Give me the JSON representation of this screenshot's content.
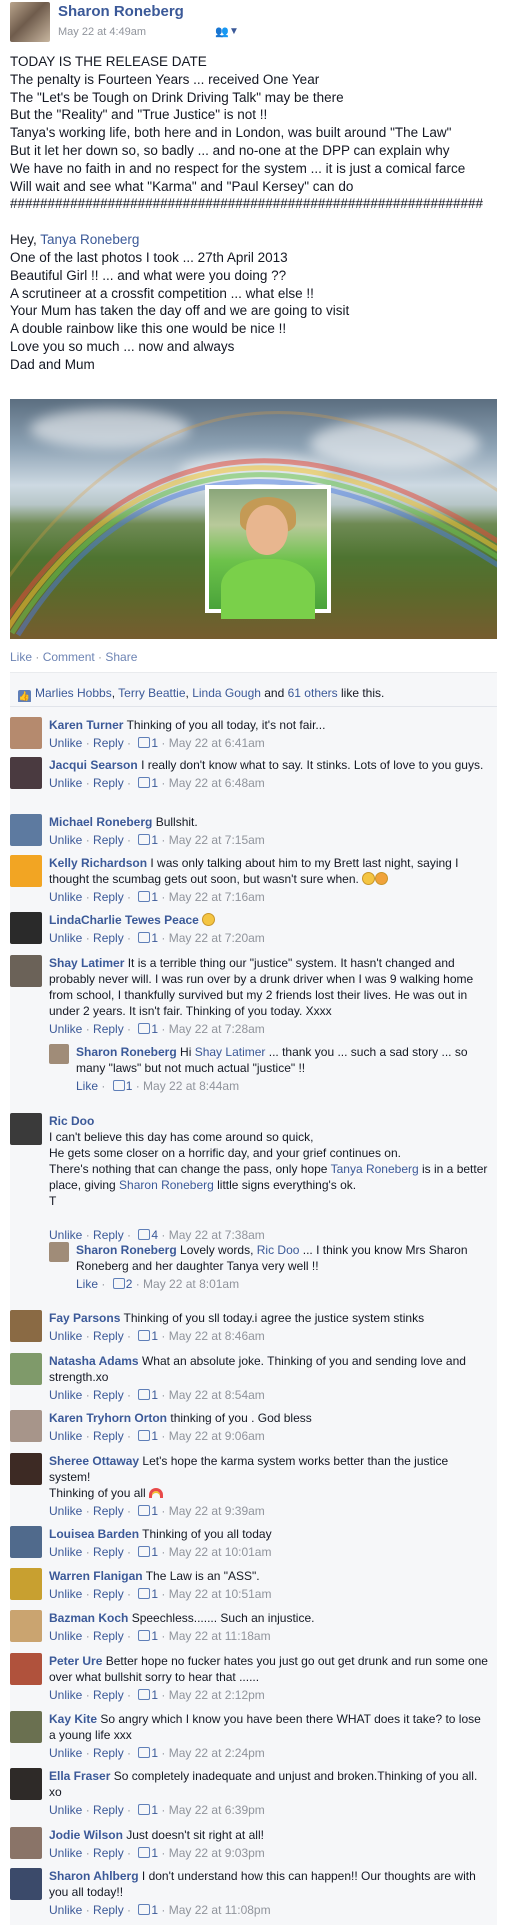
{
  "post": {
    "author": "Sharon Roneberg",
    "timestamp": "May 22 at 4:49am",
    "privacy_icon": "friends-icon",
    "text_lines": [
      "TODAY IS THE RELEASE DATE",
      "The penalty is Fourteen Years ... received One Year",
      "The \"Let's be Tough on Drink Driving Talk\" may be there",
      "But the \"Reality\" and \"True Justice\" is not !!",
      "Tanya's working life, both here and in London, was built around \"The Law\"",
      "But it let her down so, so badly ... and no-one at the DPP can explain why",
      "We have no faith in and no respect for the system ... it is just a comical farce",
      "Will wait and see what \"Karma\" and \"Paul Kersey\" can do",
      "###############################################################",
      "",
      "Hey, Tanya Roneberg",
      "One of the last photos I took ... 27th April 2013",
      "Beautiful Girl !! ... and what were you doing ??",
      "A scrutineer at a crossfit competition ... what else !!",
      "Your Mum has taken the day off and we are going to visit",
      "A double rainbow like this one would be nice !!",
      "Love you so much ... now and always",
      "Dad and Mum"
    ],
    "tagged_name": "Tanya Roneberg",
    "tag_prefix": "Hey, "
  },
  "actions": {
    "like": "Like",
    "comment": "Comment",
    "share": "Share",
    "separator": " · "
  },
  "likes": {
    "names": [
      "Marlies Hobbs",
      "Terry Beattie",
      "Linda Gough"
    ],
    "others": "61 others",
    "suffix": " like this."
  },
  "comments": [
    {
      "name": "Karen Turner",
      "text": "Thinking of you all today, it's not fair...",
      "likes": "1",
      "time": "May 22 at 6:41am",
      "avatar": "#b58a6e"
    },
    {
      "name": "Jacqui Searson",
      "text": "I really don't know what to say. It stinks. Lots of love to you guys.",
      "likes": "1",
      "time": "May 22 at 6:48am",
      "avatar": "#4a3a40"
    },
    {
      "name": "Michael Roneberg",
      "text": "Bullshit.",
      "likes": "1",
      "time": "May 22 at 7:15am",
      "avatar": "#5d7aa0"
    },
    {
      "name": "Kelly Richardson",
      "text": "I was only talking about him to my Brett last night, saying I thought the scumbag gets out soon, but wasn't sure when.",
      "likes": "1",
      "time": "May 22 at 7:16am",
      "avatar": "#f2a523"
    },
    {
      "name": "LindaCharlie Tewes Peace",
      "text": "",
      "likes": "1",
      "time": "May 22 at 7:20am",
      "avatar": "#2a2a2a"
    },
    {
      "name": "Shay Latimer",
      "text": "It is a terrible thing our \"justice\" system. It hasn't changed and probably never will. I was run over by a drunk driver when I was 9 walking home from school, I thankfully survived but my 2 friends lost their lives. He was out in under 2 years. It isn't fair. Thinking of you today. Xxxx",
      "likes": "1",
      "time": "May 22 at 7:28am",
      "avatar": "#6b6258"
    },
    {
      "name": "Sharon Roneberg",
      "reply_to": "Shay Latimer",
      "text": " ... thank you ... such a sad story ... so many \"laws\" but not much actual \"justice\" !!",
      "prefix": "Hi ",
      "likes": "1",
      "time": "May 22 at 8:44am",
      "avatar": "#a08c78"
    },
    {
      "name": "Ric Doo",
      "text_lines": [
        "I can't believe this day has come around so quick,",
        "He gets some closer on a horrific day, and your grief continues on.",
        "There's nothing that can change the pass, only hope ",
        " is in a better place, giving ",
        " little signs everything's ok.",
        "T"
      ],
      "mention1": "Tanya Roneberg",
      "mention2": "Sharon Roneberg",
      "likes": "4",
      "time": "May 22 at 7:38am",
      "avatar": "#3a3a3a"
    },
    {
      "name": "Sharon Roneberg",
      "prefix": "Lovely words, ",
      "reply_to": "Ric Doo",
      "text": " ... I think you know Mrs Sharon Roneberg and her daughter Tanya very well !!",
      "likes": "2",
      "time": "May 22 at 8:01am",
      "avatar": "#a08c78"
    },
    {
      "name": "Fay Parsons",
      "text": "Thinking of you sll today.i agree the justice system stinks",
      "likes": "1",
      "time": "May 22 at 8:46am",
      "avatar": "#8a6a44"
    },
    {
      "name": "Natasha Adams",
      "text": "What an absolute joke. Thinking of you and sending love and strength.xo",
      "likes": "1",
      "time": "May 22 at 8:54am",
      "avatar": "#7f9a6a"
    },
    {
      "name": "Karen Tryhorn Orton",
      "text": "thinking of you . God bless",
      "likes": "1",
      "time": "May 22 at 9:06am",
      "avatar": "#a7958a"
    },
    {
      "name": "Sheree Ottaway",
      "text": "Let's hope the karma system works better than the justice system!",
      "text2": "Thinking of you all ",
      "likes": "1",
      "time": "May 22 at 9:39am",
      "avatar": "#3d2a24"
    },
    {
      "name": "Louisea Barden",
      "text": "Thinking of you all today",
      "likes": "1",
      "time": "May 22 at 10:01am",
      "avatar": "#506a8c"
    },
    {
      "name": "Warren Flanigan",
      "text": "The Law is an \"ASS\".",
      "likes": "1",
      "time": "May 22 at 10:51am",
      "avatar": "#c8a030"
    },
    {
      "name": "Bazman Koch",
      "text": "Speechless....... Such an injustice.",
      "likes": "1",
      "time": "May 22 at 11:18am",
      "avatar": "#caa470"
    },
    {
      "name": "Peter Ure",
      "text": "Better hope no fucker hates you just go out get drunk and run some one over what bullshit sorry to hear that ......",
      "likes": "1",
      "time": "May 22 at 2:12pm",
      "avatar": "#b0523c"
    },
    {
      "name": "Kay Kite",
      "text": "So angry which I know you have been there WHAT does it take? to lose a young life xxx",
      "likes": "1",
      "time": "May 22 at 2:24pm",
      "avatar": "#6a7050"
    },
    {
      "name": "Ella Fraser",
      "text": "So completely inadequate and unjust and broken.Thinking of you all. xo",
      "likes": "1",
      "time": "May 22 at 6:39pm",
      "avatar": "#2e2a28"
    },
    {
      "name": "Jodie Wilson",
      "text": "Just doesn't sit right at all!",
      "likes": "1",
      "time": "May 22 at 9:03pm",
      "avatar": "#8a7468"
    },
    {
      "name": "Sharon Ahlberg",
      "text": "I don't understand how this can happen!! Our thoughts are with you all today!!",
      "likes": "1",
      "time": "May 22 at 11:08pm",
      "avatar": "#3b4a6a"
    }
  ],
  "labels": {
    "unlike": "Unlike",
    "like": "Like",
    "reply": "Reply",
    "dot": " · "
  }
}
